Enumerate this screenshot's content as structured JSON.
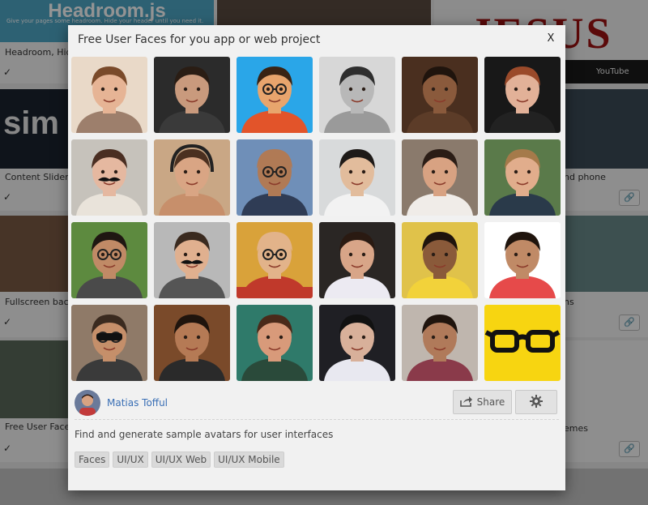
{
  "modal": {
    "title": "Free User Faces for you app or web project",
    "close_label": "X",
    "author_name": "Matias Tofful",
    "share_label": "Share",
    "description": "Find and generate sample avatars for user interfaces",
    "tags": [
      "Faces",
      "UI/UX",
      "UI/UX Web",
      "UI/UX Mobile"
    ],
    "accent_color": "#3a6fb5",
    "share_icon": "share-icon",
    "settings_icon": "gear-icon"
  },
  "grid": {
    "faces": [
      {
        "kind": "man-short-hair",
        "bg": "#e9d9c8",
        "skin": "#e6b495",
        "hair": "#7a4a2a",
        "shirt": "#9d7f6c"
      },
      {
        "kind": "man-dark",
        "bg": "#2b2b2b",
        "skin": "#c99a7d",
        "hair": "#2a1d14",
        "shirt": "#3a3a3a"
      },
      {
        "kind": "cartoon-glasses",
        "bg": "#2aa6e8",
        "skin": "#e8a56d",
        "hair": "#3a2414",
        "shirt": "#e2542a"
      },
      {
        "kind": "woman-bw",
        "bg": "#d7d7d7",
        "skin": "#b8b8b8",
        "hair": "#2e2e2e",
        "shirt": "#9a9a9a"
      },
      {
        "kind": "man-closeup",
        "bg": "#4a2f1f",
        "skin": "#8a5a3c",
        "hair": "#1f140d",
        "shirt": "#5c3c28"
      },
      {
        "kind": "woman-smile",
        "bg": "#181818",
        "skin": "#e2b198",
        "hair": "#9a4a2a",
        "shirt": "#222222"
      },
      {
        "kind": "woman-mustache-mug",
        "bg": "#c6c2bb",
        "skin": "#e5b8a0",
        "hair": "#4a2e22",
        "shirt": "#e9e3da"
      },
      {
        "kind": "man-headphones",
        "bg": "#c9a785",
        "skin": "#d9a584",
        "hair": "#4b3020",
        "shirt": "#c78f6b"
      },
      {
        "kind": "man-bald-thinking",
        "bg": "#6f8fb8",
        "skin": "#b07a55",
        "hair": "#b07a55",
        "shirt": "#2f3c55"
      },
      {
        "kind": "man-white-shirt",
        "bg": "#d8dadb",
        "skin": "#e2bc9c",
        "hair": "#1e1a18",
        "shirt": "#f2f2f2"
      },
      {
        "kind": "man-side",
        "bg": "#8a7a6c",
        "skin": "#d8a282",
        "hair": "#2b1d16",
        "shirt": "#f0ece8"
      },
      {
        "kind": "man-beard-outdoor",
        "bg": "#5a7a4a",
        "skin": "#e1ad8c",
        "hair": "#a57a4a",
        "shirt": "#2a3a4a"
      },
      {
        "kind": "man-glasses-green",
        "bg": "#5d8a3f",
        "skin": "#c08a66",
        "hair": "#1f1712",
        "shirt": "#4a4a4a"
      },
      {
        "kind": "man-mustache",
        "bg": "#b8b8b8",
        "skin": "#e0b08f",
        "hair": "#3a2a1f",
        "shirt": "#555555"
      },
      {
        "kind": "kosmar",
        "bg": "#d9a23a",
        "skin": "#e2b38a",
        "hair": "#e2b38a",
        "shirt": "#c0392b"
      },
      {
        "kind": "man-dark-room",
        "bg": "#2a2624",
        "skin": "#d8a588",
        "hair": "#2a1a12",
        "shirt": "#eceaf2"
      },
      {
        "kind": "man-yellow",
        "bg": "#e0c24a",
        "skin": "#8a5a3a",
        "hair": "#1f140d",
        "shirt": "#f2d23a"
      },
      {
        "kind": "man-surprised",
        "bg": "#ffffff",
        "skin": "#c08a66",
        "hair": "#1f140d",
        "shirt": "#e64a4a"
      },
      {
        "kind": "man-sunglasses",
        "bg": "#8f7a68",
        "skin": "#c58f6a",
        "hair": "#3a2a1f",
        "shirt": "#3a3a3a"
      },
      {
        "kind": "man-smile-brown",
        "bg": "#7a4a2a",
        "skin": "#b57a55",
        "hair": "#1f140d",
        "shirt": "#2a2a2a"
      },
      {
        "kind": "man-shout-green",
        "bg": "#2f7a6a",
        "skin": "#d89a7a",
        "hair": "#4a2a1a",
        "shirt": "#2a4a3a"
      },
      {
        "kind": "party-crowd",
        "bg": "#1f1f24",
        "skin": "#d8b09a",
        "hair": "#111111",
        "shirt": "#e8e8f0"
      },
      {
        "kind": "man-drinking",
        "bg": "#bfb6ae",
        "skin": "#b07a5a",
        "hair": "#1f140d",
        "shirt": "#8a3a4a"
      },
      {
        "kind": "glasses-yellow",
        "bg": "#f7d511",
        "skin": "#f7d511",
        "hair": "#111111",
        "shirt": "#f7d511"
      }
    ]
  },
  "background": {
    "top_left_banner": "Headroom.js",
    "top_left_banner_sub": "Give your pages some headroom. Hide your header until you need it.",
    "big_red_text": "JESUS",
    "sim_text": "sim",
    "captions": [
      "Headroom, Hide",
      "Content Slider,",
      "Fullscreen back",
      "Free User Faces",
      "nd phone",
      "ns",
      "emes"
    ],
    "check_mark": "✓",
    "link_icon": "link-icon",
    "youtube_label": "YouTube"
  }
}
